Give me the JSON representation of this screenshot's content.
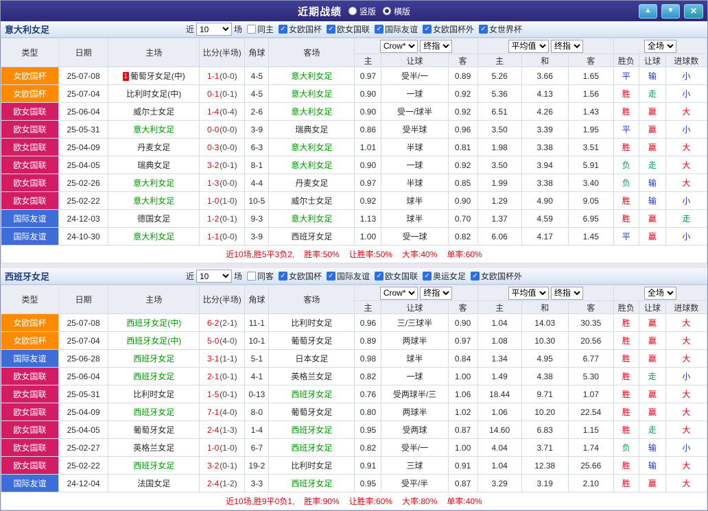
{
  "header": {
    "title": "近期战绩",
    "layouts": [
      {
        "label": "竖版",
        "selected": false
      },
      {
        "label": "横版",
        "selected": true
      }
    ],
    "up_icon": "▲",
    "down_icon": "▼",
    "close_icon": "✕"
  },
  "columns": {
    "statics": [
      "类型",
      "日期",
      "主场",
      "比分(半场)",
      "角球",
      "客场"
    ],
    "odds_group": {
      "provider": "Crow*",
      "stage": "终指",
      "subs": [
        "主",
        "让球",
        "客"
      ]
    },
    "avg_group": {
      "provider": "平均值",
      "stage": "终指",
      "subs": [
        "主",
        "和",
        "客"
      ]
    },
    "scope_group": {
      "scope": "全场",
      "subs": [
        "胜负",
        "让球",
        "进球数"
      ]
    }
  },
  "colors": {
    "type": {
      "女欧国杯": "#ff8a00",
      "欧女国联": "#d41c63",
      "国际友谊": "#3e6cd8"
    },
    "result": {
      "胜": "#e60012",
      "赢": "#e60012",
      "大": "#e60012",
      "平": "#2233cc",
      "输": "#2233cc",
      "小": "#2233cc",
      "负": "#0a9a50",
      "走": "#0a9a50"
    },
    "tracked_team": "#009900",
    "score": "#e60012",
    "half_score": "#444444",
    "summary": "#e60012"
  },
  "sections": [
    {
      "team": "意大利女足",
      "filter": {
        "near_label": "近",
        "count": "10",
        "unit_label": "场",
        "same": {
          "label": "同主",
          "checked": false
        },
        "competitions": [
          {
            "label": "女欧国杯",
            "checked": true
          },
          {
            "label": "欧女国联",
            "checked": true
          },
          {
            "label": "国际友谊",
            "checked": true
          },
          {
            "label": "女欧国杯外",
            "checked": true
          },
          {
            "label": "女世界杯",
            "checked": true
          }
        ]
      },
      "rows": [
        {
          "type": "女欧国杯",
          "date": "25-07-08",
          "home": "葡萄牙女足(中)",
          "home_tracked": false,
          "home_badge": "1",
          "score": "1-1",
          "half": "(0-0)",
          "corner": "4-5",
          "away": "意大利女足",
          "away_tracked": true,
          "odds_home": "0.97",
          "handicap": "受半/一",
          "odds_away": "0.89",
          "avg_home": "5.26",
          "avg_draw": "3.66",
          "avg_away": "1.65",
          "res_wdl": "平",
          "res_handicap": "输",
          "res_goals": "小"
        },
        {
          "type": "女欧国杯",
          "date": "25-07-04",
          "home": "比利时女足(中)",
          "home_tracked": false,
          "home_badge": "",
          "score": "0-1",
          "half": "(0-1)",
          "corner": "4-5",
          "away": "意大利女足",
          "away_tracked": true,
          "odds_home": "0.90",
          "handicap": "一球",
          "odds_away": "0.92",
          "avg_home": "5.36",
          "avg_draw": "4.13",
          "avg_away": "1.56",
          "res_wdl": "胜",
          "res_handicap": "走",
          "res_goals": "小"
        },
        {
          "type": "欧女国联",
          "date": "25-06-04",
          "home": "威尔士女足",
          "home_tracked": false,
          "home_badge": "",
          "score": "1-4",
          "half": "(0-4)",
          "corner": "2-6",
          "away": "意大利女足",
          "away_tracked": true,
          "odds_home": "0.90",
          "handicap": "受一/球半",
          "odds_away": "0.92",
          "avg_home": "6.51",
          "avg_draw": "4.26",
          "avg_away": "1.43",
          "res_wdl": "胜",
          "res_handicap": "赢",
          "res_goals": "大"
        },
        {
          "type": "欧女国联",
          "date": "25-05-31",
          "home": "意大利女足",
          "home_tracked": true,
          "home_badge": "",
          "score": "0-0",
          "half": "(0-0)",
          "corner": "3-9",
          "away": "瑞典女足",
          "away_tracked": false,
          "odds_home": "0.86",
          "handicap": "受半球",
          "odds_away": "0.96",
          "avg_home": "3.50",
          "avg_draw": "3.39",
          "avg_away": "1.95",
          "res_wdl": "平",
          "res_handicap": "赢",
          "res_goals": "小"
        },
        {
          "type": "欧女国联",
          "date": "25-04-09",
          "home": "丹麦女足",
          "home_tracked": false,
          "home_badge": "",
          "score": "0-3",
          "half": "(0-0)",
          "corner": "6-3",
          "away": "意大利女足",
          "away_tracked": true,
          "odds_home": "1.01",
          "handicap": "半球",
          "odds_away": "0.81",
          "avg_home": "1.98",
          "avg_draw": "3.38",
          "avg_away": "3.51",
          "res_wdl": "胜",
          "res_handicap": "赢",
          "res_goals": "大"
        },
        {
          "type": "欧女国联",
          "date": "25-04-05",
          "home": "瑞典女足",
          "home_tracked": false,
          "home_badge": "",
          "score": "3-2",
          "half": "(0-1)",
          "corner": "8-1",
          "away": "意大利女足",
          "away_tracked": true,
          "odds_home": "0.90",
          "handicap": "一球",
          "odds_away": "0.92",
          "avg_home": "3.50",
          "avg_draw": "3.94",
          "avg_away": "5.91",
          "res_wdl": "负",
          "res_handicap": "走",
          "res_goals": "大"
        },
        {
          "type": "欧女国联",
          "date": "25-02-26",
          "home": "意大利女足",
          "home_tracked": true,
          "home_badge": "",
          "score": "1-3",
          "half": "(0-0)",
          "corner": "4-4",
          "away": "丹麦女足",
          "away_tracked": false,
          "odds_home": "0.97",
          "handicap": "半球",
          "odds_away": "0.85",
          "avg_home": "1.99",
          "avg_draw": "3.38",
          "avg_away": "3.40",
          "res_wdl": "负",
          "res_handicap": "输",
          "res_goals": "大"
        },
        {
          "type": "欧女国联",
          "date": "25-02-22",
          "home": "意大利女足",
          "home_tracked": true,
          "home_badge": "",
          "score": "1-0",
          "half": "(1-0)",
          "corner": "10-5",
          "away": "威尔士女足",
          "away_tracked": false,
          "odds_home": "0.92",
          "handicap": "球半",
          "odds_away": "0.90",
          "avg_home": "1.29",
          "avg_draw": "4.90",
          "avg_away": "9.05",
          "res_wdl": "胜",
          "res_handicap": "输",
          "res_goals": "小"
        },
        {
          "type": "国际友谊",
          "date": "24-12-03",
          "home": "德国女足",
          "home_tracked": false,
          "home_badge": "",
          "score": "1-2",
          "half": "(0-1)",
          "corner": "9-3",
          "away": "意大利女足",
          "away_tracked": true,
          "odds_home": "1.13",
          "handicap": "球半",
          "odds_away": "0.70",
          "avg_home": "1.37",
          "avg_draw": "4.59",
          "avg_away": "6.95",
          "res_wdl": "胜",
          "res_handicap": "赢",
          "res_goals": "走"
        },
        {
          "type": "国际友谊",
          "date": "24-10-30",
          "home": "意大利女足",
          "home_tracked": true,
          "home_badge": "",
          "score": "1-1",
          "half": "(0-0)",
          "corner": "3-9",
          "away": "西班牙女足",
          "away_tracked": false,
          "odds_home": "1.00",
          "handicap": "受一球",
          "odds_away": "0.82",
          "avg_home": "6.06",
          "avg_draw": "4.17",
          "avg_away": "1.45",
          "res_wdl": "平",
          "res_handicap": "赢",
          "res_goals": "小"
        }
      ],
      "summary_parts": [
        "近10场,胜5平3负2,",
        "胜率:50%",
        "让胜率:50%",
        "大率:40%",
        "单率:60%"
      ]
    },
    {
      "team": "西班牙女足",
      "filter": {
        "near_label": "近",
        "count": "10",
        "unit_label": "场",
        "same": {
          "label": "同客",
          "checked": false
        },
        "competitions": [
          {
            "label": "女欧国杯",
            "checked": true
          },
          {
            "label": "国际友谊",
            "checked": true
          },
          {
            "label": "欧女国联",
            "checked": true
          },
          {
            "label": "奥运女足",
            "checked": true
          },
          {
            "label": "女欧国杯外",
            "checked": true
          }
        ]
      },
      "rows": [
        {
          "type": "女欧国杯",
          "date": "25-07-08",
          "home": "西班牙女足(中)",
          "home_tracked": true,
          "home_badge": "",
          "score": "6-2",
          "half": "(2-1)",
          "corner": "11-1",
          "away": "比利时女足",
          "away_tracked": false,
          "odds_home": "0.96",
          "handicap": "三/三球半",
          "odds_away": "0.90",
          "avg_home": "1.04",
          "avg_draw": "14.03",
          "avg_away": "30.35",
          "res_wdl": "胜",
          "res_handicap": "赢",
          "res_goals": "大"
        },
        {
          "type": "女欧国杯",
          "date": "25-07-04",
          "home": "西班牙女足(中)",
          "home_tracked": true,
          "home_badge": "",
          "score": "5-0",
          "half": "(4-0)",
          "corner": "10-1",
          "away": "葡萄牙女足",
          "away_tracked": false,
          "odds_home": "0.89",
          "handicap": "两球半",
          "odds_away": "0.97",
          "avg_home": "1.08",
          "avg_draw": "10.30",
          "avg_away": "20.56",
          "res_wdl": "胜",
          "res_handicap": "赢",
          "res_goals": "大"
        },
        {
          "type": "国际友谊",
          "date": "25-06-28",
          "home": "西班牙女足",
          "home_tracked": true,
          "home_badge": "",
          "score": "3-1",
          "half": "(1-1)",
          "corner": "5-1",
          "away": "日本女足",
          "away_tracked": false,
          "odds_home": "0.98",
          "handicap": "球半",
          "odds_away": "0.84",
          "avg_home": "1.34",
          "avg_draw": "4.95",
          "avg_away": "6.77",
          "res_wdl": "胜",
          "res_handicap": "赢",
          "res_goals": "大"
        },
        {
          "type": "欧女国联",
          "date": "25-06-04",
          "home": "西班牙女足",
          "home_tracked": true,
          "home_badge": "",
          "score": "2-1",
          "half": "(0-1)",
          "corner": "4-1",
          "away": "英格兰女足",
          "away_tracked": false,
          "odds_home": "0.82",
          "handicap": "一球",
          "odds_away": "1.00",
          "avg_home": "1.49",
          "avg_draw": "4.38",
          "avg_away": "5.30",
          "res_wdl": "胜",
          "res_handicap": "走",
          "res_goals": "小"
        },
        {
          "type": "欧女国联",
          "date": "25-05-31",
          "home": "比利时女足",
          "home_tracked": false,
          "home_badge": "",
          "score": "1-5",
          "half": "(0-1)",
          "corner": "0-13",
          "away": "西班牙女足",
          "away_tracked": true,
          "odds_home": "0.76",
          "handicap": "受两球半/三",
          "odds_away": "1.06",
          "avg_home": "18.44",
          "avg_draw": "9.71",
          "avg_away": "1.07",
          "res_wdl": "胜",
          "res_handicap": "赢",
          "res_goals": "大"
        },
        {
          "type": "欧女国联",
          "date": "25-04-09",
          "home": "西班牙女足",
          "home_tracked": true,
          "home_badge": "",
          "score": "7-1",
          "half": "(4-0)",
          "corner": "8-0",
          "away": "葡萄牙女足",
          "away_tracked": false,
          "odds_home": "0.80",
          "handicap": "两球半",
          "odds_away": "1.02",
          "avg_home": "1.06",
          "avg_draw": "10.20",
          "avg_away": "22.54",
          "res_wdl": "胜",
          "res_handicap": "赢",
          "res_goals": "大"
        },
        {
          "type": "欧女国联",
          "date": "25-04-05",
          "home": "葡萄牙女足",
          "home_tracked": false,
          "home_badge": "",
          "score": "2-4",
          "half": "(1-3)",
          "corner": "1-4",
          "away": "西班牙女足",
          "away_tracked": true,
          "odds_home": "0.95",
          "handicap": "受两球",
          "odds_away": "0.87",
          "avg_home": "14.60",
          "avg_draw": "6.83",
          "avg_away": "1.15",
          "res_wdl": "胜",
          "res_handicap": "走",
          "res_goals": "大"
        },
        {
          "type": "欧女国联",
          "date": "25-02-27",
          "home": "英格兰女足",
          "home_tracked": false,
          "home_badge": "",
          "score": "1-0",
          "half": "(1-0)",
          "corner": "6-7",
          "away": "西班牙女足",
          "away_tracked": true,
          "odds_home": "0.82",
          "handicap": "受半/一",
          "odds_away": "1.00",
          "avg_home": "4.04",
          "avg_draw": "3.71",
          "avg_away": "1.74",
          "res_wdl": "负",
          "res_handicap": "输",
          "res_goals": "小"
        },
        {
          "type": "欧女国联",
          "date": "25-02-22",
          "home": "西班牙女足",
          "home_tracked": true,
          "home_badge": "",
          "score": "3-2",
          "half": "(0-1)",
          "corner": "19-2",
          "away": "比利时女足",
          "away_tracked": false,
          "odds_home": "0.91",
          "handicap": "三球",
          "odds_away": "0.91",
          "avg_home": "1.04",
          "avg_draw": "12.38",
          "avg_away": "25.66",
          "res_wdl": "胜",
          "res_handicap": "输",
          "res_goals": "大"
        },
        {
          "type": "国际友谊",
          "date": "24-12-04",
          "home": "法国女足",
          "home_tracked": false,
          "home_badge": "",
          "score": "2-4",
          "half": "(1-2)",
          "corner": "3-3",
          "away": "西班牙女足",
          "away_tracked": true,
          "odds_home": "0.95",
          "handicap": "受平/半",
          "odds_away": "0.87",
          "avg_home": "3.29",
          "avg_draw": "3.19",
          "avg_away": "2.10",
          "res_wdl": "胜",
          "res_handicap": "赢",
          "res_goals": "大"
        }
      ],
      "summary_parts": [
        "近10场,胜9平0负1,",
        "胜率:90%",
        "让胜率:60%",
        "大率:80%",
        "单率:40%"
      ]
    }
  ]
}
